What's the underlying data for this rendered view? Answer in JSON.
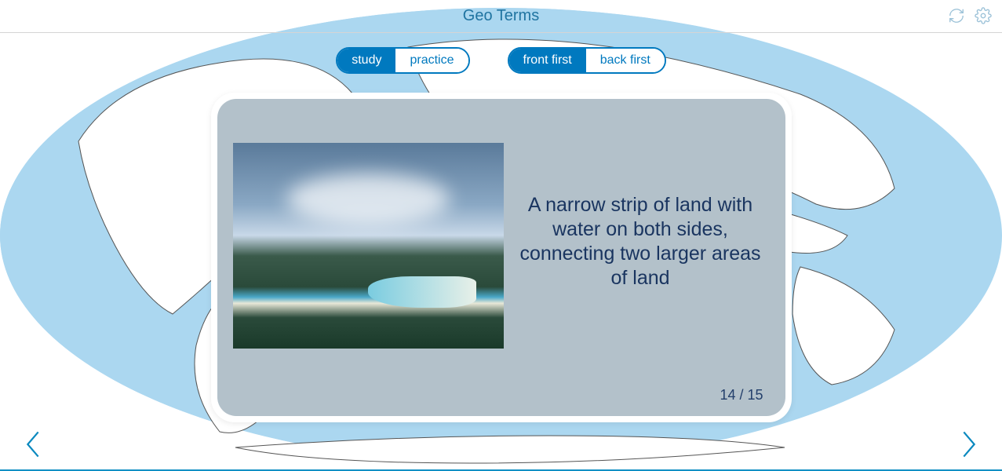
{
  "header": {
    "title": "Geo Terms"
  },
  "toggles": {
    "mode": {
      "study": "study",
      "practice": "practice"
    },
    "order": {
      "front": "front first",
      "back": "back first"
    }
  },
  "card": {
    "definition": "A narrow strip of land with water on both sides, connecting two larger areas of land",
    "image_alt": "isthmus-photo",
    "current": "14",
    "total": "15",
    "indicator": "14 / 15"
  }
}
